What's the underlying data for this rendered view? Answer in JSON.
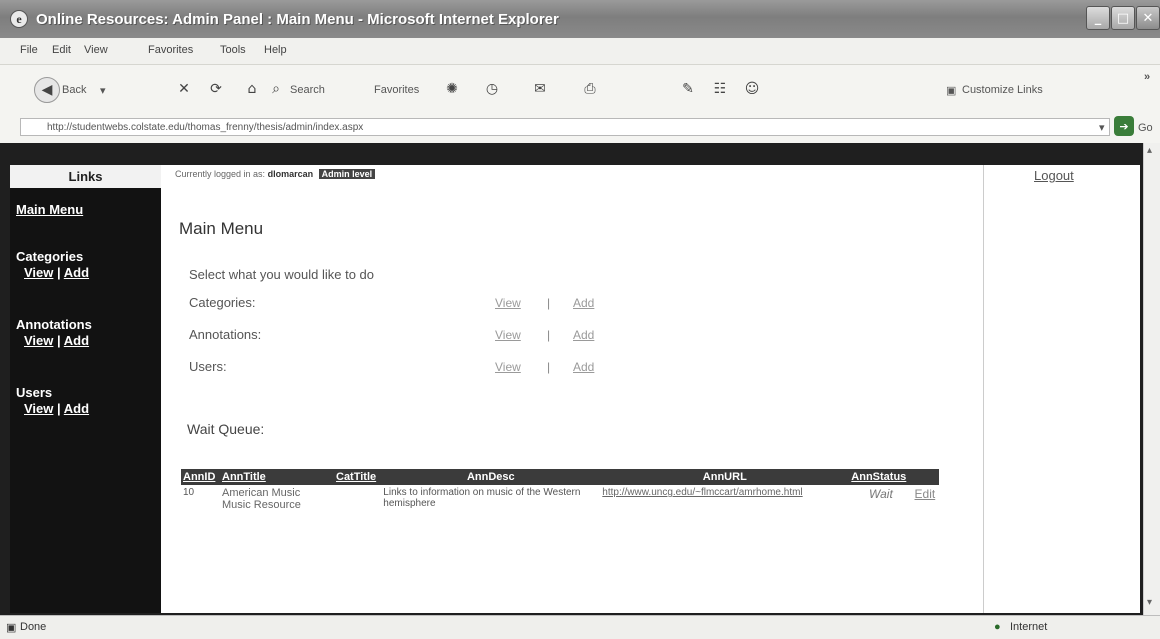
{
  "window": {
    "title": "Online Resources: Admin Panel : Main Menu - Microsoft Internet Explorer"
  },
  "menu": [
    "File",
    "Edit",
    "View",
    "Favorites",
    "Tools",
    "Help"
  ],
  "toolbar": {
    "back": "Back",
    "search": "Search",
    "favorites": "Favorites",
    "customize_links": "Customize Links"
  },
  "address": {
    "url": "http://studentwebs.colstate.edu/thomas_frenny/thesis/admin/index.aspx",
    "go": "Go"
  },
  "sidebar": {
    "header": "Links",
    "main_menu": "Main Menu",
    "sections": [
      {
        "title": "Categories",
        "view": "View",
        "sep": "|",
        "add": "Add"
      },
      {
        "title": "Annotations",
        "view": "View",
        "sep": "|",
        "add": "Add"
      },
      {
        "title": "Users",
        "view": "View",
        "sep": "|",
        "add": "Add"
      }
    ]
  },
  "main": {
    "login_prefix": "Currently logged in as:",
    "username": "dlomarcan",
    "badge": "Admin level",
    "title": "Main Menu",
    "instruction": "Select what you would like to do",
    "rows": [
      {
        "label": "Categories:",
        "view": "View",
        "sep": "|",
        "add": "Add"
      },
      {
        "label": "Annotations:",
        "view": "View",
        "sep": "|",
        "add": "Add"
      },
      {
        "label": "Users:",
        "view": "View",
        "sep": "|",
        "add": "Add"
      }
    ],
    "wait_queue_title": "Wait Queue:",
    "table": {
      "headers": [
        "AnnID",
        "AnnTitle",
        "CatTitle",
        "AnnDesc",
        "AnnURL",
        "AnnStatus",
        ""
      ],
      "rows": [
        {
          "id": "10",
          "title": "American Music Music Resource",
          "cat": "",
          "desc": "Links to information on music of the Western hemisphere",
          "url": "http://www.uncg.edu/~flmccart/amrhome.html",
          "status": "Wait",
          "edit": "Edit"
        }
      ]
    }
  },
  "right": {
    "logout": "Logout"
  },
  "status": {
    "done": "Done",
    "zone": "Internet"
  }
}
